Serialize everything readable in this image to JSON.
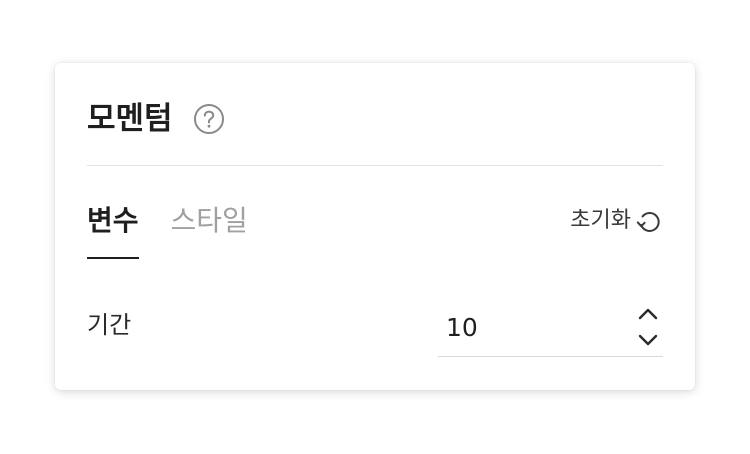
{
  "panel": {
    "title": "모멘텀",
    "help_icon": "question-circle-icon"
  },
  "tabs": [
    {
      "label": "변수",
      "active": true
    },
    {
      "label": "스타일",
      "active": false
    }
  ],
  "reset": {
    "label": "초기화",
    "icon": "reset-rotate-icon"
  },
  "fields": {
    "period": {
      "label": "기간",
      "value": "10"
    }
  },
  "colors": {
    "text_primary": "#1f1f1f",
    "text_muted": "#a0a0a0",
    "divider": "#e2e2e2"
  }
}
